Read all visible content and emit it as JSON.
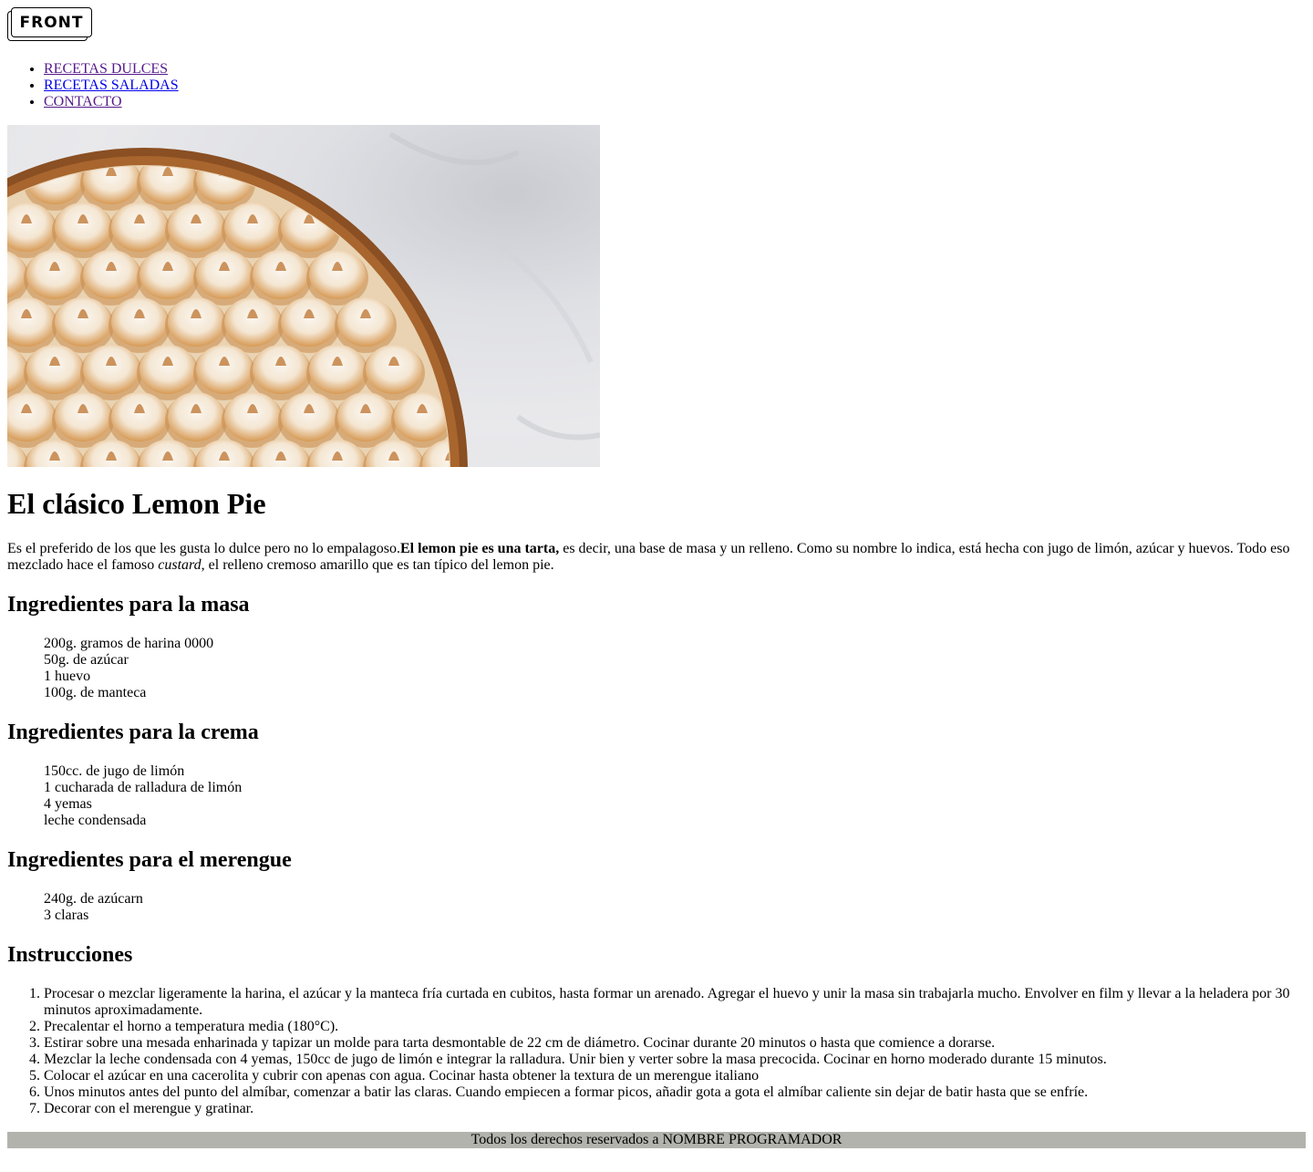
{
  "logo": {
    "text": "FRONT"
  },
  "nav": {
    "items": [
      {
        "label": "RECETAS DULCES"
      },
      {
        "label": "RECETAS SALADAS"
      },
      {
        "label": "CONTACTO"
      }
    ]
  },
  "hero": {
    "image_subject": "lemon-pie-meringue-photo"
  },
  "recipe": {
    "title": "El clásico Lemon Pie",
    "intro_start": "Es el preferido de los que les gusta lo dulce pero no lo empalagoso.",
    "intro_bold": "El lemon pie es una tarta,",
    "intro_mid": " es decir, una base de masa y un relleno. Como su nombre lo indica, está hecha con jugo de limón, azúcar y huevos. Todo eso mezclado hace el famoso ",
    "intro_em": "custard",
    "intro_end": ", el relleno cremoso amarillo que es tan típico del lemon pie.",
    "masa": {
      "heading": "Ingredientes para la masa",
      "items": [
        "200g. gramos de harina 0000",
        "50g. de azúcar",
        "1 huevo",
        "100g. de manteca"
      ]
    },
    "crema": {
      "heading": "Ingredientes para la crema",
      "items": [
        "150cc. de jugo de limón",
        "1 cucharada de ralladura de limón",
        "4 yemas",
        "leche condensada"
      ]
    },
    "merengue": {
      "heading": "Ingredientes para el merengue",
      "items": [
        "240g. de azúcarn",
        "3 claras"
      ]
    },
    "instrucciones": {
      "heading": "Instrucciones",
      "steps": [
        "Procesar o mezclar ligeramente la harina, el azúcar y la manteca fría curtada en cubitos, hasta formar un arenado. Agregar el huevo y unir la masa sin trabajarla mucho. Envolver en film y llevar a la heladera por 30 minutos aproximadamente.",
        "Precalentar el horno a temperatura media (180°C).",
        "Estirar sobre una mesada enharinada y tapizar un molde para tarta desmontable de 22 cm de diámetro. Cocinar durante 20 minutos o hasta que comience a dorarse.",
        "Mezclar la leche condensada con 4 yemas, 150cc de jugo de limón e integrar la ralladura. Unir bien y verter sobre la masa precocida. Cocinar en horno moderado durante 15 minutos.",
        "Colocar el azúcar en una cacerolita y cubrir con apenas con agua. Cocinar hasta obtener la textura de un merengue italiano",
        "Unos minutos antes del punto del almíbar, comenzar a batir las claras. Cuando empiecen a formar picos, añadir gota a gota el almíbar caliente sin dejar de batir hasta que se enfríe.",
        "Decorar con el merengue y gratinar."
      ]
    }
  },
  "footer": {
    "text": "Todos los derechos reservados a NOMBRE PROGRAMADOR"
  },
  "colors": {
    "link": "#0000ee",
    "link_visited": "#551a8b",
    "footer_bg": "#b3b3ae"
  }
}
